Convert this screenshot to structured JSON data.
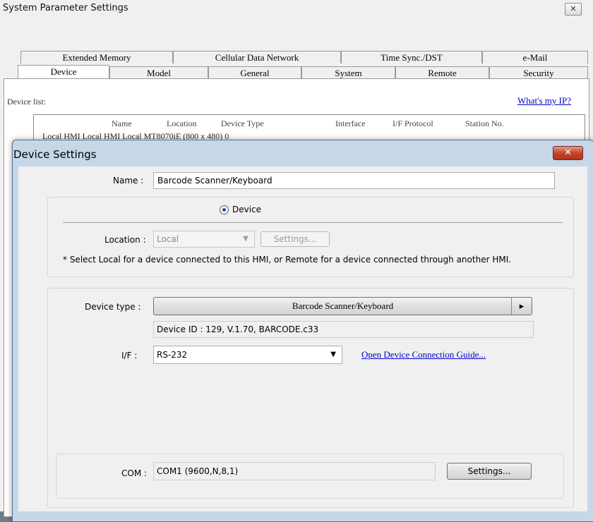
{
  "outer": {
    "title": "System Parameter Settings",
    "close_glyph": "✕",
    "tabs_row1": [
      "Extended Memory",
      "Cellular Data Network",
      "Time Sync./DST",
      "e-Mail"
    ],
    "tabs_row2": [
      "Device",
      "Model",
      "General",
      "System",
      "Remote",
      "Security"
    ],
    "device_list_label": "Device list:",
    "ip_link": "What's my IP?",
    "columns": [
      "Name",
      "Location",
      "Device Type",
      "Interface",
      "I/F Protocol",
      "Station No."
    ],
    "row_text": "Local HMI  Local HMI  Local       MT8070iE (800 x 480)                                                  0"
  },
  "dialog": {
    "title": "Device Settings",
    "close_glyph": "✕",
    "name_label": "Name :",
    "name_value": "Barcode Scanner/Keyboard",
    "radio_device": "Device",
    "location_label": "Location :",
    "location_value": "Local",
    "location_settings": "Settings...",
    "note": "* Select Local for a device connected to this HMI, or Remote for a device connected through another HMI.",
    "device_type_label": "Device type :",
    "device_type_value": "Barcode Scanner/Keyboard",
    "device_type_arrow": "▸",
    "device_id": "Device ID : 129, V.1.70, BARCODE.c33",
    "if_label": "I/F :",
    "if_value": "RS-232",
    "guide_link": "Open Device Connection Guide...",
    "com_label": "COM :",
    "com_value": "COM1 (9600,N,8,1)",
    "com_settings": "Settings..."
  }
}
